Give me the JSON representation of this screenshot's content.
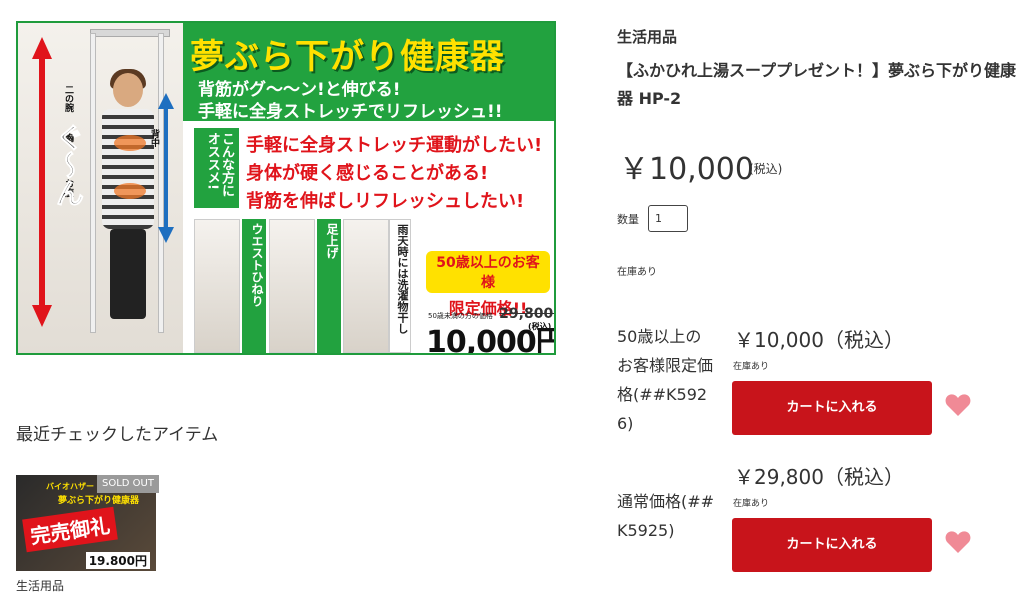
{
  "banner": {
    "title": "夢ぶら下がり健康器",
    "sub1": "背筋がグ～～ン!と伸びる!",
    "sub2": "手軽に全身ストレッチでリフレッシュ!!",
    "recommend": "こんな方にオススメ!",
    "points": [
      "手軽に全身ストレッチ運動がしたい!",
      "身体が硬く感じることがある!",
      "背筋を伸ばしリフレッシュしたい!"
    ],
    "body_labels": [
      "二の腕",
      "胸",
      "お腹",
      "背中"
    ],
    "gun": "ぐ～ん",
    "tags": [
      "ウエストひねり",
      "足上げ",
      "雨天時には洗濯物干し"
    ],
    "age_line1": "50歳以上のお客様",
    "age_line2": "限定価格!!",
    "old_price_caption": "50歳未満の方の価格",
    "old_price": "29,800円が",
    "new_price": "10,000円",
    "new_price_tax": "(税込)"
  },
  "recent": {
    "heading": "最近チェックしたアイテム",
    "thumb_top1": "バイオハザー",
    "thumb_top2": "夢ぶら下がり健康器",
    "thumb_badge": "完売御礼",
    "thumb_price": "19.800円",
    "sold_out": "SOLD OUT",
    "category": "生活用品"
  },
  "product": {
    "category": "生活用品",
    "title": "【ふかひれ上湯スーププレゼント！】夢ぶら下がり健康器 HP-2",
    "price": "￥10,000",
    "price_tax": "(税込)",
    "quantity_label": "数量",
    "quantity_value": "1",
    "stock": "在庫あり"
  },
  "variants": [
    {
      "label": "50歳以上のお客様限定価格(##K5926)",
      "price": "￥10,000（税込）",
      "stock": "在庫あり",
      "cart_label": "カートに入れる"
    },
    {
      "label": "通常価格(##K5925)",
      "price": "￥29,800（税込）",
      "stock": "在庫あり",
      "cart_label": "カートに入れる"
    }
  ],
  "colors": {
    "accent_red": "#c8141b",
    "banner_green": "#22a23f",
    "heart_pink": "#f08a96"
  },
  "icons": [
    "heart-icon",
    "up-down-arrow-icon"
  ]
}
